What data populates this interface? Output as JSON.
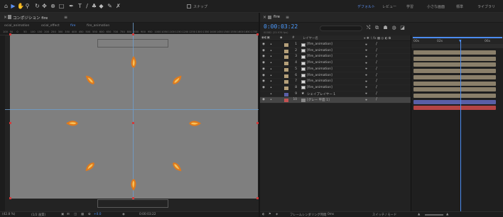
{
  "colors": {
    "accent": "#4c8cf0",
    "canvas": "#7f7f7f",
    "footage": "#8a7f6a",
    "shape": "#5a5fa6",
    "solid": "#b54444",
    "label_tan": "#b5a07a",
    "label_shape": "#5a5fa6",
    "label_solid": "#c45252"
  },
  "toolbar": {
    "tools": [
      {
        "icon": "home-icon",
        "glyph": "⌂"
      },
      {
        "icon": "select-tool-icon",
        "glyph": "▶"
      },
      {
        "icon": "hand-tool-icon",
        "glyph": "✋"
      },
      {
        "icon": "zoom-tool-icon",
        "glyph": "⚲"
      },
      {
        "icon": "rotate-tool-icon",
        "glyph": "↻"
      },
      {
        "icon": "camera-tool-icon",
        "glyph": "✥"
      },
      {
        "icon": "pan-behind-icon",
        "glyph": "⊕"
      },
      {
        "icon": "rectangle-tool-icon",
        "glyph": "□"
      },
      {
        "icon": "pen-tool-icon",
        "glyph": "✒"
      },
      {
        "icon": "type-tool-icon",
        "glyph": "T"
      },
      {
        "icon": "brush-tool-icon",
        "glyph": "/"
      },
      {
        "icon": "stamp-tool-icon",
        "glyph": "♣"
      },
      {
        "icon": "eraser-tool-icon",
        "glyph": "◆"
      },
      {
        "icon": "roto-brush-icon",
        "glyph": "✎"
      },
      {
        "icon": "puppet-pin-icon",
        "glyph": "✗"
      }
    ],
    "snap_label": "スナップ",
    "workspaces": [
      "デフォルト",
      "レビュー",
      "学習",
      "小さな画面",
      "標準",
      "ライブラリ"
    ]
  },
  "comp": {
    "tab_title": "コンポジション fire",
    "breadcrumbs": [
      "ocial_animation",
      "ocial_effect",
      "fire",
      "fire_animation"
    ],
    "ruler": [
      "100",
      "50",
      "0",
      "50",
      "100",
      "150",
      "200",
      "250",
      "300",
      "350",
      "400",
      "450",
      "500",
      "550",
      "600",
      "650",
      "700",
      "750",
      "800",
      "850",
      "900",
      "950",
      "1000",
      "1050",
      "1100",
      "1150",
      "1200",
      "1250",
      "1300",
      "1350",
      "1400",
      "1450",
      "1500",
      "1550",
      "1600",
      "1650",
      "1700"
    ],
    "status": {
      "zoom": "(42.8 %)",
      "resolution": "(1/2 画質)",
      "exposure": "+0.0",
      "time": "0:00:03:22"
    }
  },
  "timeline": {
    "tab_title": "fire",
    "timecode": "0:00:03:22",
    "frame_info": "00082 (23.976 fps)",
    "col_layer_name": "レイヤー名",
    "col_switches": "⚹ ✱ ∖ fx ▩ ◎ ◐ ⧉",
    "col_label": "#",
    "layers": [
      {
        "num": "1",
        "name": "[fire_animation]",
        "type": "footage"
      },
      {
        "num": "2",
        "name": "[fire_animation]",
        "type": "footage"
      },
      {
        "num": "3",
        "name": "[fire_animation]",
        "type": "footage"
      },
      {
        "num": "4",
        "name": "[fire_animation]",
        "type": "footage"
      },
      {
        "num": "5",
        "name": "[fire_animation]",
        "type": "footage"
      },
      {
        "num": "6",
        "name": "[fire_animation]",
        "type": "footage"
      },
      {
        "num": "7",
        "name": "[fire_animation]",
        "type": "footage"
      },
      {
        "num": "8",
        "name": "[fire_animation]",
        "type": "footage"
      },
      {
        "num": "9",
        "name": "シェイプレイヤー 1",
        "type": "shape"
      },
      {
        "num": "10",
        "name": "[グレー 平面 1]",
        "type": "solid"
      }
    ],
    "ruler_ticks": [
      "00s",
      "02s",
      "04s",
      "06s"
    ],
    "status": {
      "toggle_label": "フレームレンダリング時間",
      "toggle_value": "0ms",
      "switch_mode": "スイッチ / モード"
    }
  }
}
